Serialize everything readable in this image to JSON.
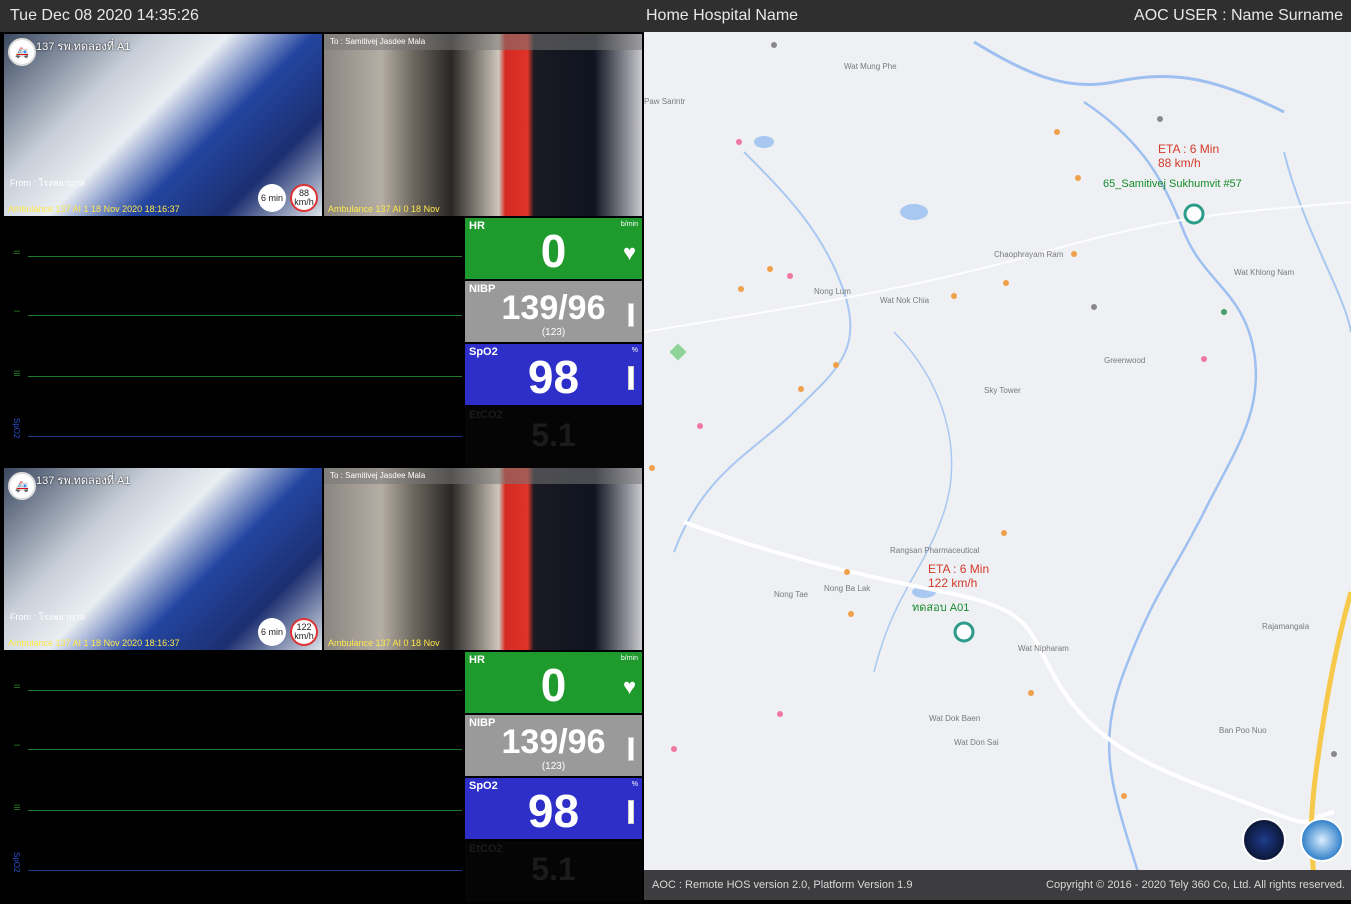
{
  "header": {
    "datetime": "Tue Dec 08 2020 14:35:26",
    "hospital": "Home Hospital Name",
    "user": "AOC USER : Name Surname"
  },
  "panels": [
    {
      "cam1_caption": "137 รพ.ทดลองที่ A1",
      "cam1_from": "From : โรงพยาบาล",
      "cam1_stamp": "Ambulance 137 AI 1 18 Nov 2020 18:16:37",
      "cam2_caption": "To : Samitivej Jasdee Mala",
      "cam2_stamp": "Ambulance 137 AI 0 18 Nov",
      "badge_eta": "6 min",
      "badge_speed": "88 km/h",
      "hr_label": "HR",
      "hr_unit": "b/min",
      "hr_value": "0",
      "nibp_label": "NIBP",
      "nibp_value": "139/96",
      "nibp_map": "(123)",
      "spo2_label": "SpO2",
      "spo2_unit": "%",
      "spo2_value": "98",
      "etco2_label": "EtCO2",
      "etco2_value": "5.1",
      "wave_labels": [
        "II",
        "I",
        "III",
        "SpO2"
      ]
    },
    {
      "cam1_caption": "137 รพ.ทดลองที่ A1",
      "cam1_from": "From : โรงพยาบาล",
      "cam1_stamp": "Ambulance 137 AI 1 18 Nov 2020 18:16:37",
      "cam2_caption": "To : Samitivej Jasdee Mala",
      "cam2_stamp": "Ambulance 137 AI 0 18 Nov",
      "badge_eta": "6 min",
      "badge_speed": "122 km/h",
      "hr_label": "HR",
      "hr_unit": "b/min",
      "hr_value": "0",
      "nibp_label": "NIBP",
      "nibp_value": "139/96",
      "nibp_map": "(123)",
      "spo2_label": "SpO2",
      "spo2_unit": "%",
      "spo2_value": "98",
      "etco2_label": "EtCO2",
      "etco2_value": "5.1",
      "wave_labels": [
        "II",
        "I",
        "III",
        "SpO2"
      ]
    }
  ],
  "map": {
    "eta1_line1": "ETA : 6 Min",
    "eta1_line2": "88 km/h",
    "dest1": "65_Samitivej Sukhumvit #57",
    "eta2_line1": "ETA : 6 Min",
    "eta2_line2": "122 km/h",
    "dest2": "ทดสอบ A01",
    "places": [
      "Wat Mung Phe",
      "Nong Lum",
      "Chaophrayam Ram",
      "Wat Nok Chia",
      "Rangsan Pharmaceutical",
      "Sky Tower",
      "Greenwood",
      "Nong Tae",
      "Nong Ba Lak",
      "Paw Sarintr",
      "Wat Khlong Nam",
      "Ban Poo Nuo",
      "Wat Nipharam",
      "Wat Dok Baen",
      "Wat Don Sai",
      "Rajamangala"
    ]
  },
  "footer": {
    "version": "AOC : Remote HOS version 2.0, Platform Version 1.9",
    "copyright": "Copyright © 2016 - 2020 Tely 360 Co, Ltd. All rights reserved."
  }
}
